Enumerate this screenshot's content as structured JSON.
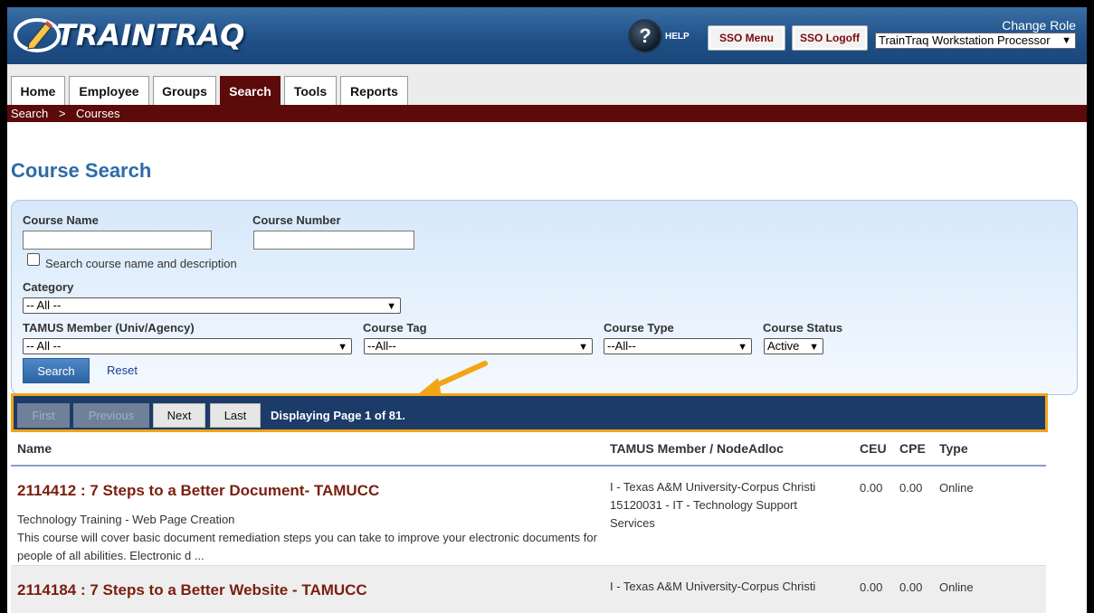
{
  "header": {
    "logo_text": "TRAINTRAQ",
    "help_label": "HELP",
    "sso_menu": "SSO Menu",
    "sso_logoff": "SSO Logoff",
    "change_role": "Change Role",
    "role_selected": "TrainTraq Workstation Processor"
  },
  "tabs": [
    {
      "label": "Home"
    },
    {
      "label": "Employee"
    },
    {
      "label": "Groups"
    },
    {
      "label": "Search",
      "active": true
    },
    {
      "label": "Tools"
    },
    {
      "label": "Reports"
    }
  ],
  "breadcrumb": {
    "root": "Search",
    "sep": ">",
    "current": "Courses"
  },
  "page_title": "Course Search",
  "form": {
    "course_name_label": "Course Name",
    "course_name_value": "",
    "course_number_label": "Course Number",
    "course_number_value": "",
    "search_desc_label": "Search course name and description",
    "category_label": "Category",
    "category_value": "-- All --",
    "member_label": "TAMUS Member (Univ/Agency)",
    "member_value": "-- All --",
    "tag_label": "Course Tag",
    "tag_value": "--All--",
    "type_label": "Course Type",
    "type_value": "--All--",
    "status_label": "Course Status",
    "status_value": "Active",
    "search_button": "Search",
    "reset_link": "Reset"
  },
  "pager": {
    "first": "First",
    "previous": "Previous",
    "next": "Next",
    "last": "Last",
    "status": "Displaying Page 1 of 81."
  },
  "table": {
    "columns": [
      "Name",
      "TAMUS Member / NodeAdloc",
      "CEU",
      "CPE",
      "Type"
    ],
    "rows": [
      {
        "title": "2114412 : 7 Steps to a Better Document- TAMUCC",
        "category": "Technology Training - Web Page Creation",
        "description": "This course will cover basic document remediation steps you can take to improve your electronic documents for people of all abilities. Electronic d ...",
        "member": "I - Texas A&M University-Corpus Christi 15120031 - IT - Technology Support Services",
        "ceu": "0.00",
        "cpe": "0.00",
        "type": "Online"
      },
      {
        "title": "2114184 : 7 Steps to a Better Website - TAMUCC",
        "member": "I - Texas A&M University-Corpus Christi",
        "ceu": "0.00",
        "cpe": "0.00",
        "type": "Online"
      }
    ]
  },
  "colors": {
    "header_blue": "#1e4f86",
    "maroon": "#5c0a0a",
    "title_blue": "#2e6aa8",
    "pager_navy": "#1c3b69",
    "highlight_orange": "#f2a516"
  }
}
